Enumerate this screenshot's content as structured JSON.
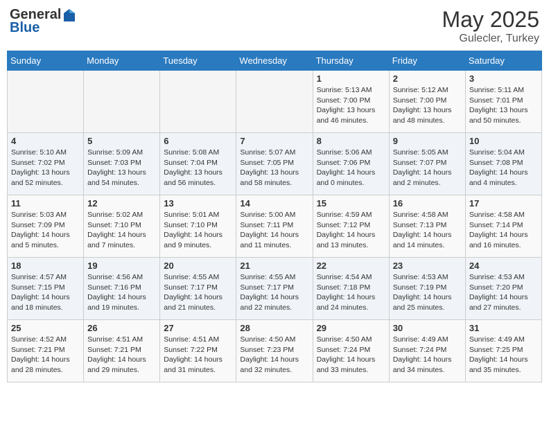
{
  "header": {
    "logo_line1": "General",
    "logo_line2": "Blue",
    "month_year": "May 2025",
    "location": "Gulecler, Turkey"
  },
  "days_of_week": [
    "Sunday",
    "Monday",
    "Tuesday",
    "Wednesday",
    "Thursday",
    "Friday",
    "Saturday"
  ],
  "weeks": [
    [
      {
        "day": "",
        "info": ""
      },
      {
        "day": "",
        "info": ""
      },
      {
        "day": "",
        "info": ""
      },
      {
        "day": "",
        "info": ""
      },
      {
        "day": "1",
        "info": "Sunrise: 5:13 AM\nSunset: 7:00 PM\nDaylight: 13 hours\nand 46 minutes."
      },
      {
        "day": "2",
        "info": "Sunrise: 5:12 AM\nSunset: 7:00 PM\nDaylight: 13 hours\nand 48 minutes."
      },
      {
        "day": "3",
        "info": "Sunrise: 5:11 AM\nSunset: 7:01 PM\nDaylight: 13 hours\nand 50 minutes."
      }
    ],
    [
      {
        "day": "4",
        "info": "Sunrise: 5:10 AM\nSunset: 7:02 PM\nDaylight: 13 hours\nand 52 minutes."
      },
      {
        "day": "5",
        "info": "Sunrise: 5:09 AM\nSunset: 7:03 PM\nDaylight: 13 hours\nand 54 minutes."
      },
      {
        "day": "6",
        "info": "Sunrise: 5:08 AM\nSunset: 7:04 PM\nDaylight: 13 hours\nand 56 minutes."
      },
      {
        "day": "7",
        "info": "Sunrise: 5:07 AM\nSunset: 7:05 PM\nDaylight: 13 hours\nand 58 minutes."
      },
      {
        "day": "8",
        "info": "Sunrise: 5:06 AM\nSunset: 7:06 PM\nDaylight: 14 hours\nand 0 minutes."
      },
      {
        "day": "9",
        "info": "Sunrise: 5:05 AM\nSunset: 7:07 PM\nDaylight: 14 hours\nand 2 minutes."
      },
      {
        "day": "10",
        "info": "Sunrise: 5:04 AM\nSunset: 7:08 PM\nDaylight: 14 hours\nand 4 minutes."
      }
    ],
    [
      {
        "day": "11",
        "info": "Sunrise: 5:03 AM\nSunset: 7:09 PM\nDaylight: 14 hours\nand 5 minutes."
      },
      {
        "day": "12",
        "info": "Sunrise: 5:02 AM\nSunset: 7:10 PM\nDaylight: 14 hours\nand 7 minutes."
      },
      {
        "day": "13",
        "info": "Sunrise: 5:01 AM\nSunset: 7:10 PM\nDaylight: 14 hours\nand 9 minutes."
      },
      {
        "day": "14",
        "info": "Sunrise: 5:00 AM\nSunset: 7:11 PM\nDaylight: 14 hours\nand 11 minutes."
      },
      {
        "day": "15",
        "info": "Sunrise: 4:59 AM\nSunset: 7:12 PM\nDaylight: 14 hours\nand 13 minutes."
      },
      {
        "day": "16",
        "info": "Sunrise: 4:58 AM\nSunset: 7:13 PM\nDaylight: 14 hours\nand 14 minutes."
      },
      {
        "day": "17",
        "info": "Sunrise: 4:58 AM\nSunset: 7:14 PM\nDaylight: 14 hours\nand 16 minutes."
      }
    ],
    [
      {
        "day": "18",
        "info": "Sunrise: 4:57 AM\nSunset: 7:15 PM\nDaylight: 14 hours\nand 18 minutes."
      },
      {
        "day": "19",
        "info": "Sunrise: 4:56 AM\nSunset: 7:16 PM\nDaylight: 14 hours\nand 19 minutes."
      },
      {
        "day": "20",
        "info": "Sunrise: 4:55 AM\nSunset: 7:17 PM\nDaylight: 14 hours\nand 21 minutes."
      },
      {
        "day": "21",
        "info": "Sunrise: 4:55 AM\nSunset: 7:17 PM\nDaylight: 14 hours\nand 22 minutes."
      },
      {
        "day": "22",
        "info": "Sunrise: 4:54 AM\nSunset: 7:18 PM\nDaylight: 14 hours\nand 24 minutes."
      },
      {
        "day": "23",
        "info": "Sunrise: 4:53 AM\nSunset: 7:19 PM\nDaylight: 14 hours\nand 25 minutes."
      },
      {
        "day": "24",
        "info": "Sunrise: 4:53 AM\nSunset: 7:20 PM\nDaylight: 14 hours\nand 27 minutes."
      }
    ],
    [
      {
        "day": "25",
        "info": "Sunrise: 4:52 AM\nSunset: 7:21 PM\nDaylight: 14 hours\nand 28 minutes."
      },
      {
        "day": "26",
        "info": "Sunrise: 4:51 AM\nSunset: 7:21 PM\nDaylight: 14 hours\nand 29 minutes."
      },
      {
        "day": "27",
        "info": "Sunrise: 4:51 AM\nSunset: 7:22 PM\nDaylight: 14 hours\nand 31 minutes."
      },
      {
        "day": "28",
        "info": "Sunrise: 4:50 AM\nSunset: 7:23 PM\nDaylight: 14 hours\nand 32 minutes."
      },
      {
        "day": "29",
        "info": "Sunrise: 4:50 AM\nSunset: 7:24 PM\nDaylight: 14 hours\nand 33 minutes."
      },
      {
        "day": "30",
        "info": "Sunrise: 4:49 AM\nSunset: 7:24 PM\nDaylight: 14 hours\nand 34 minutes."
      },
      {
        "day": "31",
        "info": "Sunrise: 4:49 AM\nSunset: 7:25 PM\nDaylight: 14 hours\nand 35 minutes."
      }
    ]
  ]
}
